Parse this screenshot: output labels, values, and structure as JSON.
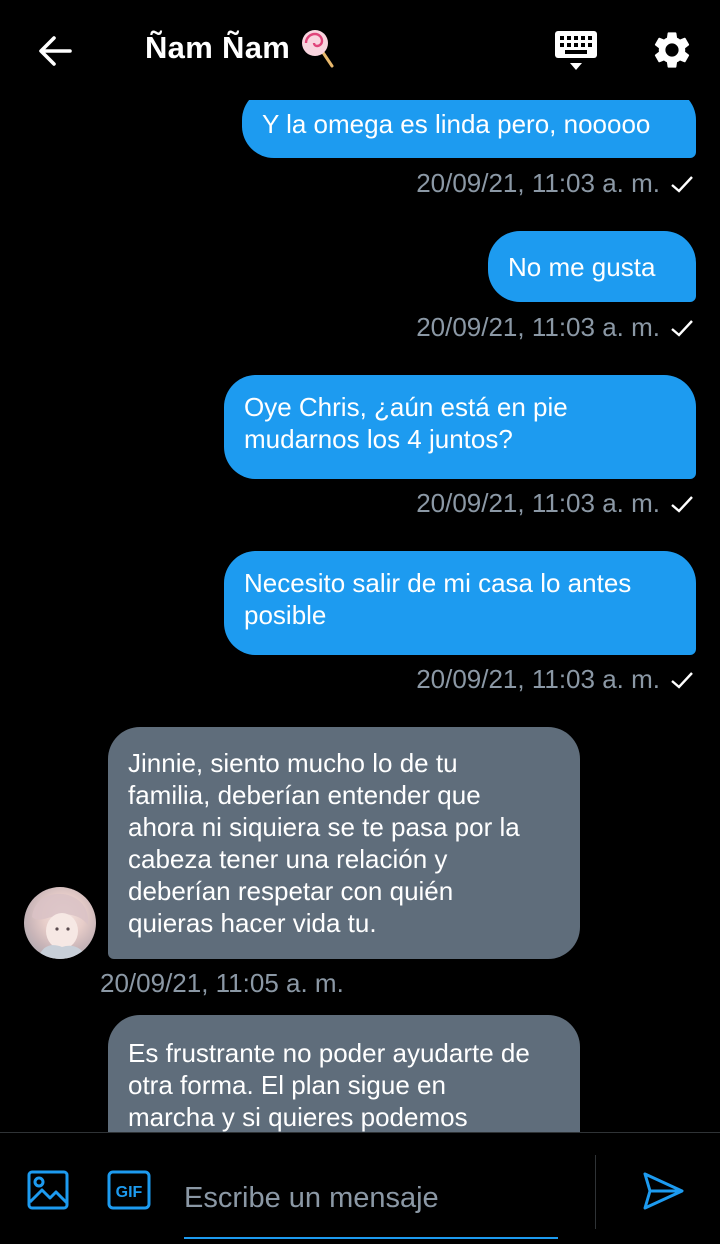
{
  "header": {
    "title": "Ñam Ñam",
    "title_emoji": "lollipop-icon"
  },
  "messages": [
    {
      "direction": "out",
      "lines": [
        "Y la omega es linda pero, nooooo"
      ],
      "timestamp": "20/09/21, 11:03 a. m.",
      "read": true
    },
    {
      "direction": "out",
      "lines": [
        "No me gusta"
      ],
      "timestamp": "20/09/21, 11:03 a. m.",
      "read": true
    },
    {
      "direction": "out",
      "lines": [
        "Oye Chris, ¿aún está en pie",
        "mudarnos los 4 juntos?"
      ],
      "timestamp": "20/09/21, 11:03 a. m.",
      "read": true
    },
    {
      "direction": "out",
      "lines": [
        "Necesito salir de mi casa lo antes",
        "posible"
      ],
      "timestamp": "20/09/21, 11:03 a. m.",
      "read": true
    },
    {
      "direction": "in",
      "lines": [
        "Jinnie, siento mucho lo de tu",
        "familia, deberían entender que",
        "ahora ni siquiera se te pasa por la",
        "cabeza tener una relación y",
        "deberían respetar con quién",
        "quieras hacer vida tu."
      ],
      "timestamp": "20/09/21, 11:05 a. m."
    },
    {
      "direction": "in",
      "lines": [
        "Es frustrante no poder ayudarte de",
        "otra forma. El plan sigue en",
        "marcha y si quieres podemos"
      ]
    }
  ],
  "composer": {
    "placeholder": "Escribe un mensaje",
    "value": ""
  },
  "colors": {
    "accent": "#1d9bf0",
    "incoming_bubble": "#5f6d7b",
    "timestamp": "#8b98a5",
    "background": "#000000"
  }
}
